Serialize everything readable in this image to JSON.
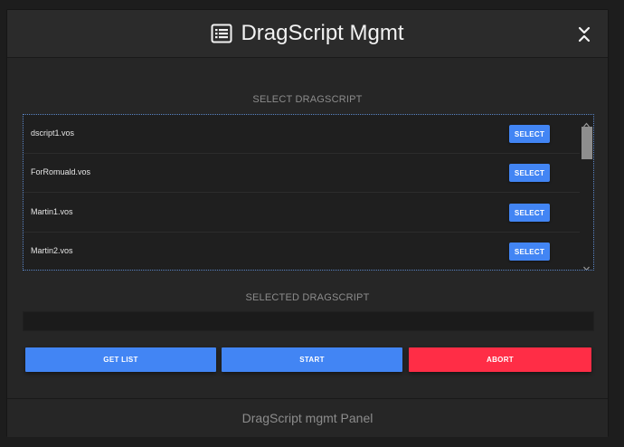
{
  "header": {
    "title": "DragScript Mgmt",
    "icon": "list-alt-icon",
    "collapse_icon": "collapse-chevrons-icon"
  },
  "list_section": {
    "label": "SELECT DRAGSCRIPT",
    "items": [
      {
        "name": "dscript1.vos",
        "button": "SELECT"
      },
      {
        "name": "ForRomuald.vos",
        "button": "SELECT"
      },
      {
        "name": "Martin1.vos",
        "button": "SELECT"
      },
      {
        "name": "Martin2.vos",
        "button": "SELECT"
      }
    ]
  },
  "selected_section": {
    "label": "SELECTED DRAGSCRIPT",
    "value": ""
  },
  "actions": {
    "get_list": "GET LIST",
    "start": "START",
    "abort": "ABORT"
  },
  "footer": {
    "text": "DragScript mgmt Panel"
  },
  "colors": {
    "primary": "#4285f4",
    "danger": "#ff2d46",
    "panel_bg": "#262626",
    "page_bg": "#1d1d1d"
  }
}
